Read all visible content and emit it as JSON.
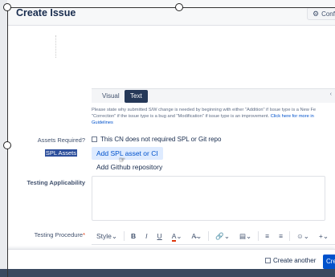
{
  "header": {
    "title": "Create Issue",
    "configure_label": "Confi",
    "configure_icon": "gear-icon"
  },
  "editor": {
    "tabs": [
      "Visual",
      "Text"
    ],
    "active_tab": "Text",
    "tab_arrow": "‹"
  },
  "help": {
    "line1": "Please state why submitted S/W change is needed by beginning with either \"Addition\" if Issue type is a New Fe",
    "line2_text": "\"Correction\" if the issue type is a bug and \"Modification\" if issue type is an improvement. ",
    "line2_link": "Click here for more in",
    "line3_link": "Guidelines"
  },
  "fields": {
    "assets_required": {
      "label": "Assets Required?",
      "checkbox_label": "This CN does not required SPL or Git repo",
      "checked": false
    },
    "spl_assets": {
      "label": "SPL Assets",
      "add_spl_button": "Add SPL asset or CI",
      "add_github_link": "Add Github repository"
    },
    "testing_applicability": {
      "label": "Testing Applicability",
      "value": ""
    },
    "testing_procedure": {
      "label": "Testing Procedure",
      "required_marker": "*"
    }
  },
  "toolbar": {
    "style": "Style",
    "bold": "B",
    "italic": "I",
    "underline": "U",
    "text_color": "A",
    "more_format": "A̶",
    "link": "🔗",
    "attachment": "☰",
    "bullet_list": "☰",
    "numbered_list": "☰",
    "emoji": "☺",
    "insert": "+"
  },
  "footer": {
    "create_another_label": "Create another",
    "create_another_checked": false,
    "create_button": "Creat"
  },
  "colors": {
    "primary": "#0052cc",
    "selected_label_bg": "#2c4e9b",
    "required": "#de350b"
  }
}
